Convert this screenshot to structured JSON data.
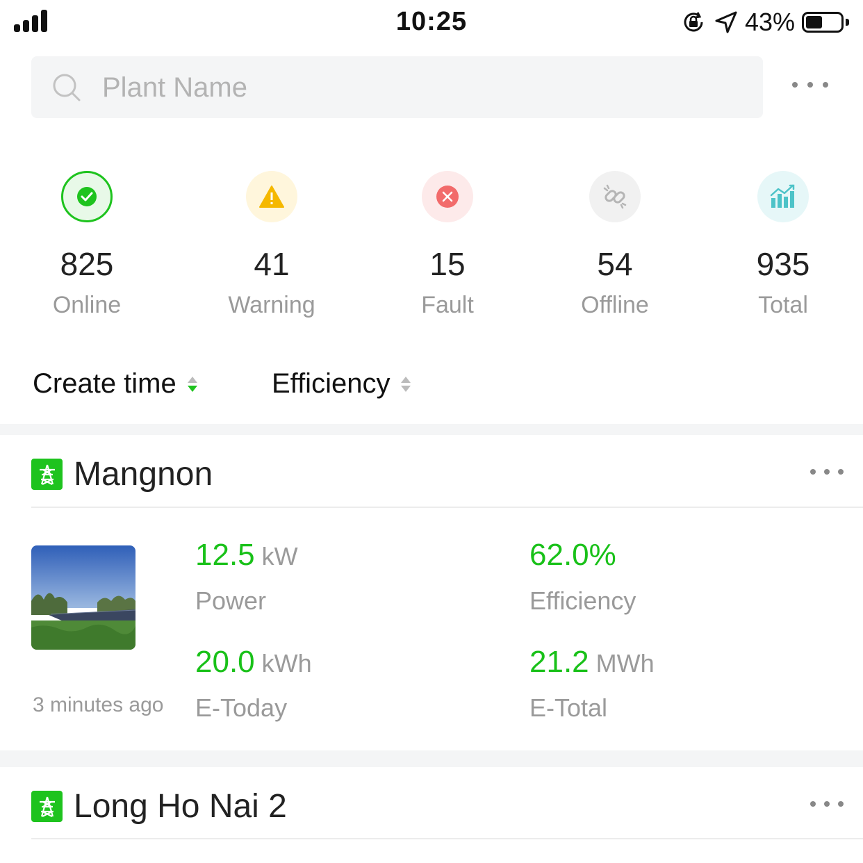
{
  "status_bar": {
    "time": "10:25",
    "battery": "43%"
  },
  "search": {
    "placeholder": "Plant Name"
  },
  "stats": [
    {
      "value": "825",
      "label": "Online",
      "color": "#1ec31e"
    },
    {
      "value": "41",
      "label": "Warning",
      "color": "#f5b800"
    },
    {
      "value": "15",
      "label": "Fault",
      "color": "#f26b6b"
    },
    {
      "value": "54",
      "label": "Offline",
      "color": "#b5b5b5"
    },
    {
      "value": "935",
      "label": "Total",
      "color": "#4dc3c8"
    }
  ],
  "sort": {
    "create_time": "Create time",
    "efficiency": "Efficiency"
  },
  "plants": [
    {
      "name": "Mangnon",
      "updated": "3 minutes ago",
      "power": {
        "value": "12.5",
        "unit": "kW",
        "label": "Power"
      },
      "efficiency": {
        "value": "62.0%",
        "label": "Efficiency"
      },
      "e_today": {
        "value": "20.0",
        "unit": "kWh",
        "label": "E-Today"
      },
      "e_total": {
        "value": "21.2",
        "unit": "MWh",
        "label": "E-Total"
      }
    },
    {
      "name": "Long Ho Nai 2"
    }
  ],
  "colors": {
    "accent": "#1ec31e",
    "value_green": "#19c119"
  }
}
